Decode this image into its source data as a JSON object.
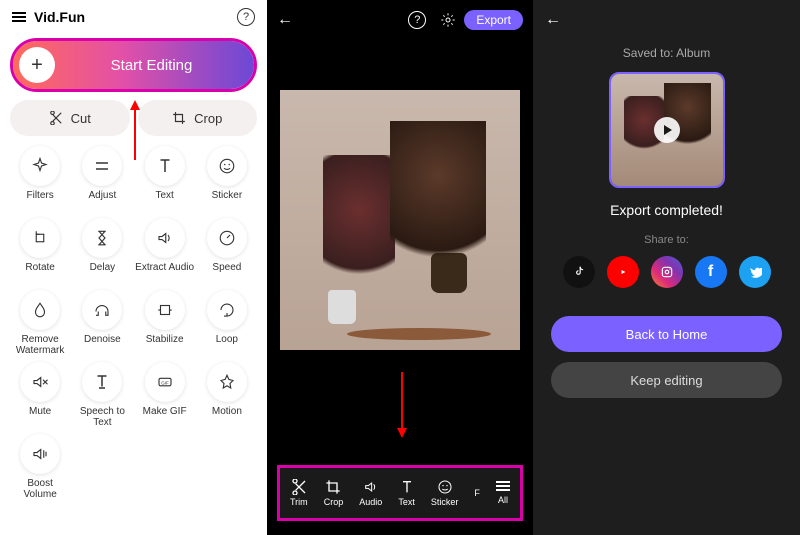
{
  "panel1": {
    "app_name": "Vid.Fun",
    "start_editing": "Start Editing",
    "cut": "Cut",
    "crop": "Crop",
    "tools": [
      {
        "label": "Filters"
      },
      {
        "label": "Adjust"
      },
      {
        "label": "Text"
      },
      {
        "label": "Sticker"
      },
      {
        "label": "Rotate"
      },
      {
        "label": "Delay"
      },
      {
        "label": "Extract Audio"
      },
      {
        "label": "Speed"
      },
      {
        "label": "Remove Watermark"
      },
      {
        "label": "Denoise"
      },
      {
        "label": "Stabilize"
      },
      {
        "label": "Loop"
      },
      {
        "label": "Mute"
      },
      {
        "label": "Speech to Text"
      },
      {
        "label": "Make GIF"
      },
      {
        "label": "Motion"
      },
      {
        "label": "Boost Volume"
      }
    ]
  },
  "panel2": {
    "export": "Export",
    "bottom": [
      {
        "label": "Trim"
      },
      {
        "label": "Crop"
      },
      {
        "label": "Audio"
      },
      {
        "label": "Text"
      },
      {
        "label": "Sticker"
      },
      {
        "label": "F"
      },
      {
        "label": "All"
      }
    ]
  },
  "panel3": {
    "saved_to": "Saved to: Album",
    "completed": "Export completed!",
    "share_to": "Share to:",
    "back_home": "Back to Home",
    "keep_editing": "Keep editing"
  }
}
